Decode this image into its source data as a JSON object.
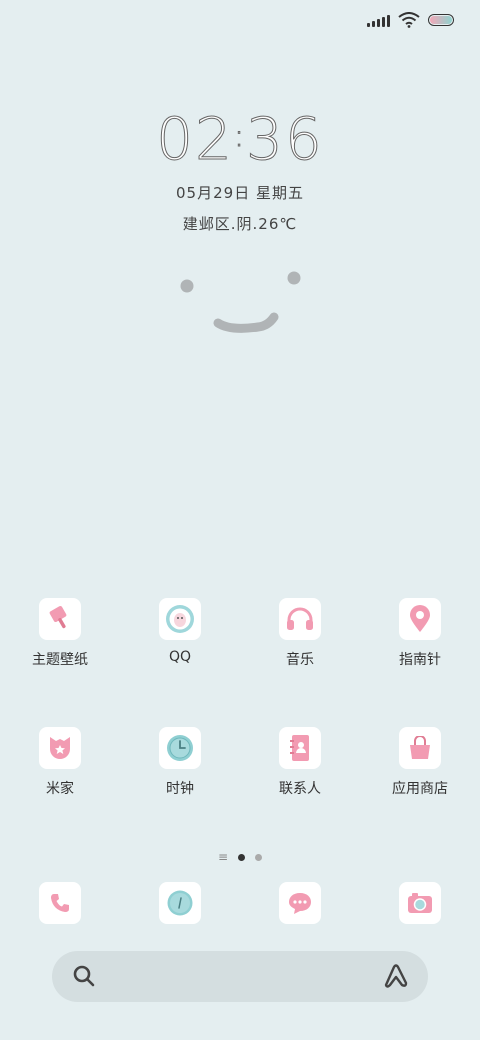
{
  "lockscreen": {
    "time_hours": "02",
    "time_sep": ":",
    "time_minutes": "36",
    "date": "05月29日  星期五",
    "weather": "建邺区.阴.26℃"
  },
  "home_rows": [
    [
      {
        "label": "主题壁纸",
        "icon": "paintbrush-icon"
      },
      {
        "label": "QQ",
        "icon": "qq-penguin-icon"
      },
      {
        "label": "音乐",
        "icon": "headphones-icon"
      },
      {
        "label": "指南针",
        "icon": "location-pin-icon"
      }
    ],
    [
      {
        "label": "米家",
        "icon": "mijia-shield-icon"
      },
      {
        "label": "时钟",
        "icon": "clock-icon"
      },
      {
        "label": "联系人",
        "icon": "contacts-book-icon"
      },
      {
        "label": "应用商店",
        "icon": "shopping-bag-icon"
      }
    ]
  ],
  "dock": [
    {
      "icon": "phone-icon"
    },
    {
      "icon": "compass-browser-icon"
    },
    {
      "icon": "message-bubble-icon"
    },
    {
      "icon": "camera-icon"
    }
  ],
  "colors": {
    "background": "#e4eef0",
    "accent_pink": "#f0a0b4",
    "accent_teal": "#8fcfd2"
  }
}
